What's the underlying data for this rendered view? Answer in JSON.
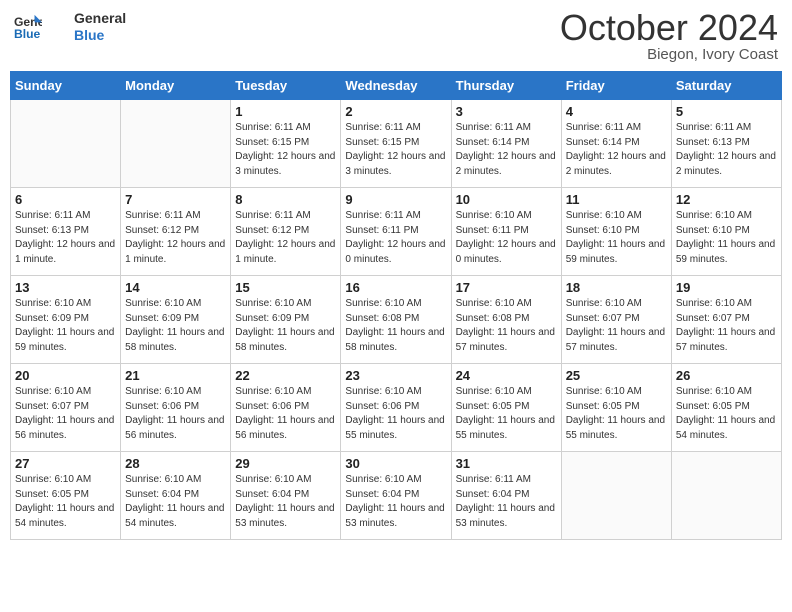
{
  "header": {
    "logo_line1": "General",
    "logo_line2": "Blue",
    "month": "October 2024",
    "location": "Biegon, Ivory Coast"
  },
  "weekdays": [
    "Sunday",
    "Monday",
    "Tuesday",
    "Wednesday",
    "Thursday",
    "Friday",
    "Saturday"
  ],
  "weeks": [
    [
      {
        "day": "",
        "info": ""
      },
      {
        "day": "",
        "info": ""
      },
      {
        "day": "1",
        "info": "Sunrise: 6:11 AM\nSunset: 6:15 PM\nDaylight: 12 hours and 3 minutes."
      },
      {
        "day": "2",
        "info": "Sunrise: 6:11 AM\nSunset: 6:15 PM\nDaylight: 12 hours and 3 minutes."
      },
      {
        "day": "3",
        "info": "Sunrise: 6:11 AM\nSunset: 6:14 PM\nDaylight: 12 hours and 2 minutes."
      },
      {
        "day": "4",
        "info": "Sunrise: 6:11 AM\nSunset: 6:14 PM\nDaylight: 12 hours and 2 minutes."
      },
      {
        "day": "5",
        "info": "Sunrise: 6:11 AM\nSunset: 6:13 PM\nDaylight: 12 hours and 2 minutes."
      }
    ],
    [
      {
        "day": "6",
        "info": "Sunrise: 6:11 AM\nSunset: 6:13 PM\nDaylight: 12 hours and 1 minute."
      },
      {
        "day": "7",
        "info": "Sunrise: 6:11 AM\nSunset: 6:12 PM\nDaylight: 12 hours and 1 minute."
      },
      {
        "day": "8",
        "info": "Sunrise: 6:11 AM\nSunset: 6:12 PM\nDaylight: 12 hours and 1 minute."
      },
      {
        "day": "9",
        "info": "Sunrise: 6:11 AM\nSunset: 6:11 PM\nDaylight: 12 hours and 0 minutes."
      },
      {
        "day": "10",
        "info": "Sunrise: 6:10 AM\nSunset: 6:11 PM\nDaylight: 12 hours and 0 minutes."
      },
      {
        "day": "11",
        "info": "Sunrise: 6:10 AM\nSunset: 6:10 PM\nDaylight: 11 hours and 59 minutes."
      },
      {
        "day": "12",
        "info": "Sunrise: 6:10 AM\nSunset: 6:10 PM\nDaylight: 11 hours and 59 minutes."
      }
    ],
    [
      {
        "day": "13",
        "info": "Sunrise: 6:10 AM\nSunset: 6:09 PM\nDaylight: 11 hours and 59 minutes."
      },
      {
        "day": "14",
        "info": "Sunrise: 6:10 AM\nSunset: 6:09 PM\nDaylight: 11 hours and 58 minutes."
      },
      {
        "day": "15",
        "info": "Sunrise: 6:10 AM\nSunset: 6:09 PM\nDaylight: 11 hours and 58 minutes."
      },
      {
        "day": "16",
        "info": "Sunrise: 6:10 AM\nSunset: 6:08 PM\nDaylight: 11 hours and 58 minutes."
      },
      {
        "day": "17",
        "info": "Sunrise: 6:10 AM\nSunset: 6:08 PM\nDaylight: 11 hours and 57 minutes."
      },
      {
        "day": "18",
        "info": "Sunrise: 6:10 AM\nSunset: 6:07 PM\nDaylight: 11 hours and 57 minutes."
      },
      {
        "day": "19",
        "info": "Sunrise: 6:10 AM\nSunset: 6:07 PM\nDaylight: 11 hours and 57 minutes."
      }
    ],
    [
      {
        "day": "20",
        "info": "Sunrise: 6:10 AM\nSunset: 6:07 PM\nDaylight: 11 hours and 56 minutes."
      },
      {
        "day": "21",
        "info": "Sunrise: 6:10 AM\nSunset: 6:06 PM\nDaylight: 11 hours and 56 minutes."
      },
      {
        "day": "22",
        "info": "Sunrise: 6:10 AM\nSunset: 6:06 PM\nDaylight: 11 hours and 56 minutes."
      },
      {
        "day": "23",
        "info": "Sunrise: 6:10 AM\nSunset: 6:06 PM\nDaylight: 11 hours and 55 minutes."
      },
      {
        "day": "24",
        "info": "Sunrise: 6:10 AM\nSunset: 6:05 PM\nDaylight: 11 hours and 55 minutes."
      },
      {
        "day": "25",
        "info": "Sunrise: 6:10 AM\nSunset: 6:05 PM\nDaylight: 11 hours and 55 minutes."
      },
      {
        "day": "26",
        "info": "Sunrise: 6:10 AM\nSunset: 6:05 PM\nDaylight: 11 hours and 54 minutes."
      }
    ],
    [
      {
        "day": "27",
        "info": "Sunrise: 6:10 AM\nSunset: 6:05 PM\nDaylight: 11 hours and 54 minutes."
      },
      {
        "day": "28",
        "info": "Sunrise: 6:10 AM\nSunset: 6:04 PM\nDaylight: 11 hours and 54 minutes."
      },
      {
        "day": "29",
        "info": "Sunrise: 6:10 AM\nSunset: 6:04 PM\nDaylight: 11 hours and 53 minutes."
      },
      {
        "day": "30",
        "info": "Sunrise: 6:10 AM\nSunset: 6:04 PM\nDaylight: 11 hours and 53 minutes."
      },
      {
        "day": "31",
        "info": "Sunrise: 6:11 AM\nSunset: 6:04 PM\nDaylight: 11 hours and 53 minutes."
      },
      {
        "day": "",
        "info": ""
      },
      {
        "day": "",
        "info": ""
      }
    ]
  ]
}
